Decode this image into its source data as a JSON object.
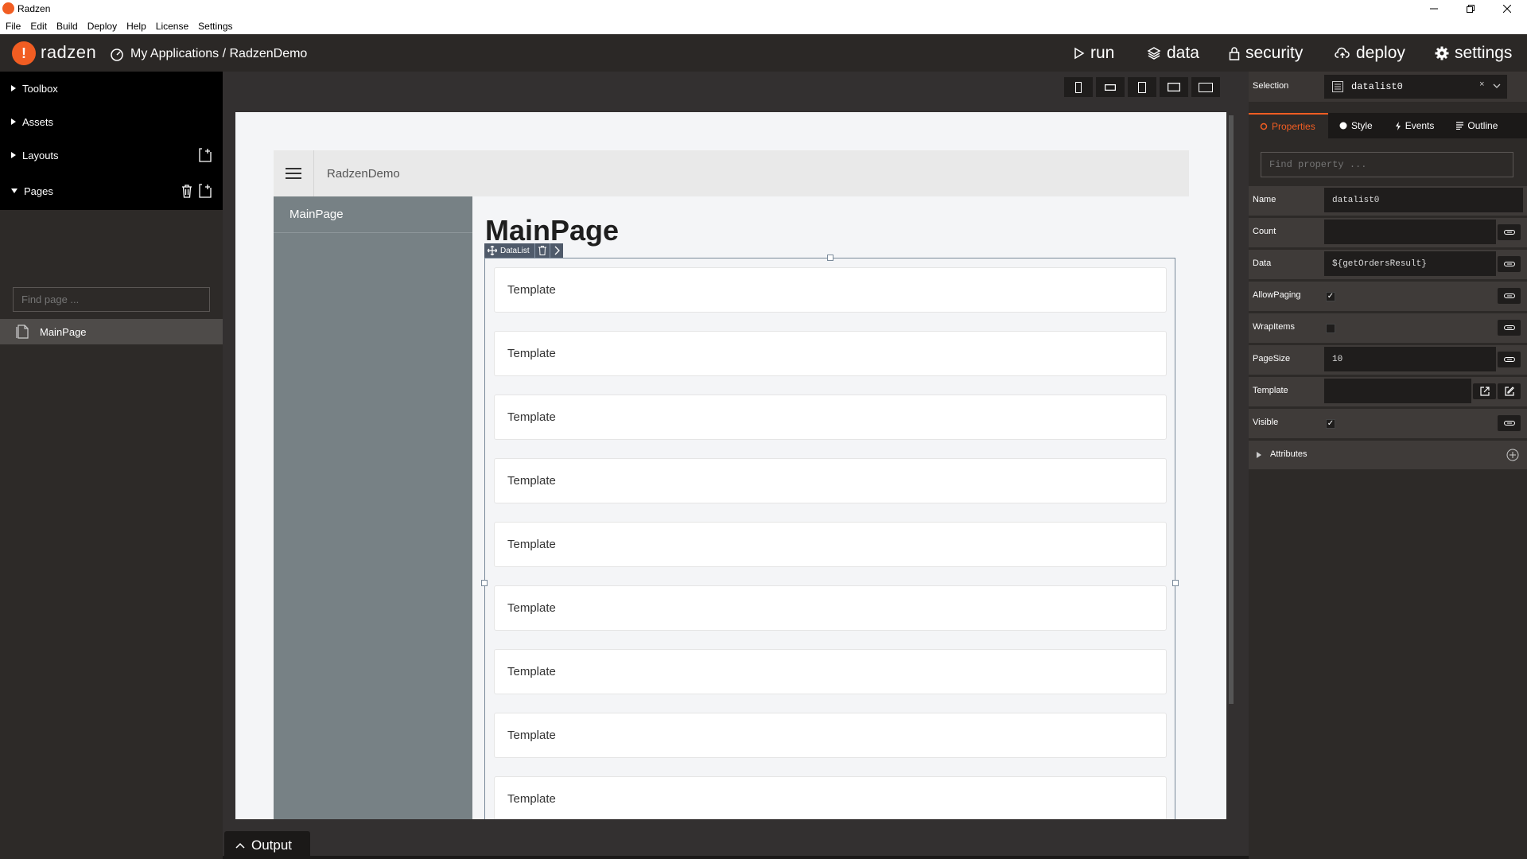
{
  "window": {
    "title": "Radzen"
  },
  "menu": [
    "File",
    "Edit",
    "Build",
    "Deploy",
    "Help",
    "License",
    "Settings"
  ],
  "header": {
    "brand": "radzen",
    "breadcrumb": "My Applications / RadzenDemo",
    "nav": [
      {
        "label": "run",
        "icon": "play-icon"
      },
      {
        "label": "data",
        "icon": "layers-icon"
      },
      {
        "label": "security",
        "icon": "lock-icon"
      },
      {
        "label": "deploy",
        "icon": "cloud-upload-icon"
      },
      {
        "label": "settings",
        "icon": "gear-icon"
      }
    ]
  },
  "sidebar": {
    "sections": [
      "Toolbox",
      "Assets",
      "Layouts",
      "Pages"
    ],
    "find_placeholder": "Find page ...",
    "pages": [
      "MainPage"
    ]
  },
  "design": {
    "app_name": "RadzenDemo",
    "nav_item": "MainPage",
    "page_title": "MainPage",
    "component_tag": "DataList",
    "template_items": [
      "Template",
      "Template",
      "Template",
      "Template",
      "Template",
      "Template",
      "Template",
      "Template",
      "Template"
    ]
  },
  "output": {
    "label": "Output"
  },
  "properties": {
    "selection_label": "Selection",
    "selection_value": "datalist0",
    "tabs": [
      "Properties",
      "Style",
      "Events",
      "Outline"
    ],
    "find_placeholder": "Find property ...",
    "rows": [
      {
        "label": "Name",
        "value": "datalist0"
      },
      {
        "label": "Count",
        "value": ""
      },
      {
        "label": "Data",
        "value": "${getOrdersResult}"
      },
      {
        "label": "AllowPaging",
        "checked": true
      },
      {
        "label": "WrapItems",
        "checked": false
      },
      {
        "label": "PageSize",
        "value": "10"
      },
      {
        "label": "Template",
        "value": ""
      },
      {
        "label": "Visible",
        "checked": true
      }
    ],
    "attributes_label": "Attributes"
  },
  "colors": {
    "accent": "#f15d22",
    "dark_bg": "#2d2a28",
    "sidebar_item": "#778185"
  }
}
